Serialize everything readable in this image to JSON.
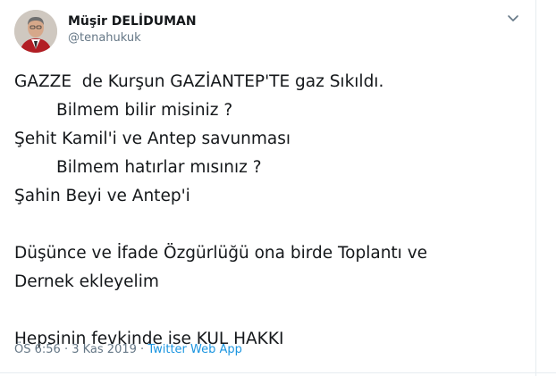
{
  "author": {
    "name": "Müşir DELİDUMAN",
    "handle": "@tenahukuk"
  },
  "tweet": {
    "lines": [
      "GAZZE  de Kurşun GAZİANTEP'TE gaz Sıkıldı.",
      "        Bilmem bilir misiniz ?",
      "Şehit Kamil'i ve Antep savunması",
      "        Bilmem hatırlar mısınız ?",
      "Şahin Beyi ve Antep'i",
      "",
      "Düşünce ve İfade Özgürlüğü ona birde Toplantı ve",
      "Dernek ekleyelim",
      "",
      "Hepsinin fevkinde ise KUL HAKKI"
    ]
  },
  "meta": {
    "time": "ÖS 6:56",
    "separator": "·",
    "date": "3 Kas 2019",
    "app": "Twitter Web App"
  },
  "icons": {
    "menu": "chevron-down-icon",
    "avatar": "user-avatar"
  },
  "colors": {
    "text": "#14171a",
    "secondary": "#657786",
    "link": "#1b95e0"
  }
}
